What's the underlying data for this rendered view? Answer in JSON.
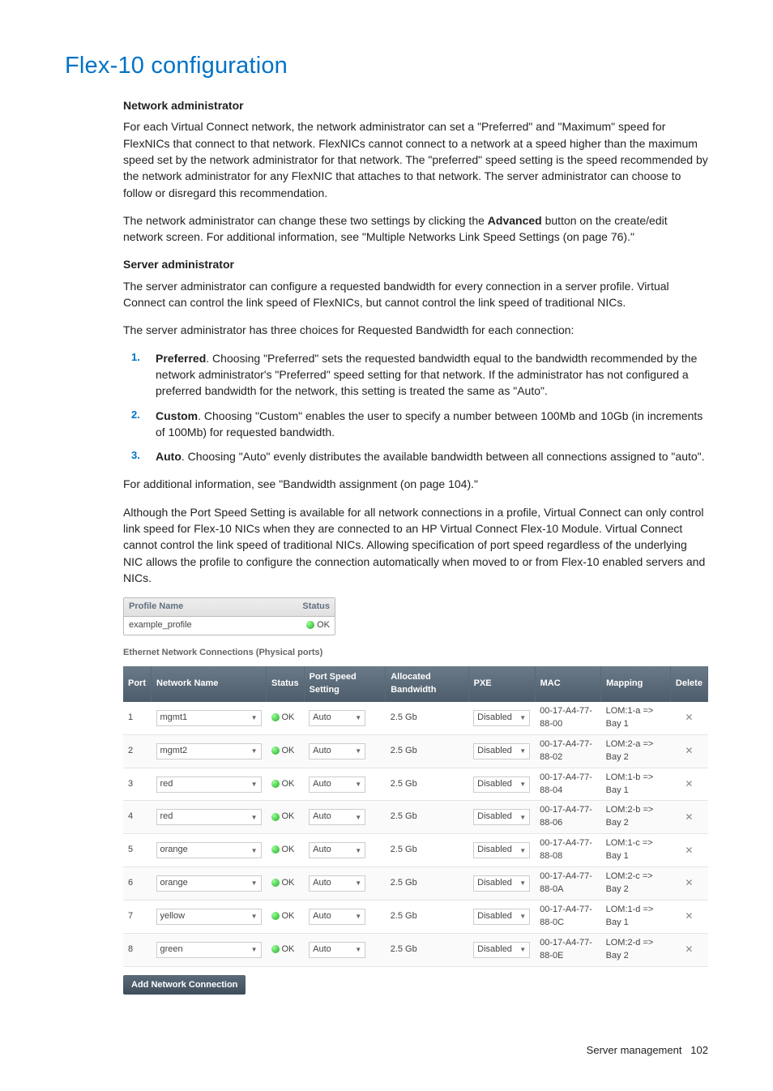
{
  "title": "Flex-10 configuration",
  "netAdmin": {
    "heading": "Network administrator",
    "p1": "For each Virtual Connect network, the network administrator can set a \"Preferred\" and \"Maximum\" speed for FlexNICs that connect to that network. FlexNICs cannot connect to a network at a speed higher than the maximum speed set by the network administrator for that network. The \"preferred\" speed setting is the speed recommended by the network administrator for any FlexNIC that attaches to that network. The server administrator can choose to follow or disregard this recommendation.",
    "p2a": "The network administrator can change these two settings by clicking the ",
    "p2b": "Advanced",
    "p2c": " button on the create/edit network screen. For additional information, see \"Multiple Networks Link Speed Settings (on page 76).\""
  },
  "srvAdmin": {
    "heading": "Server administrator",
    "p1": "The server administrator can configure a requested bandwidth for every connection in a server profile. Virtual Connect can control the link speed of FlexNICs, but cannot control the link speed of traditional NICs.",
    "p2": "The server administrator has three choices for Requested Bandwidth for each connection:",
    "li1b": "Preferred",
    "li1": ". Choosing \"Preferred\" sets the requested bandwidth equal to the bandwidth recommended by the network administrator's \"Preferred\" speed setting for that network. If the administrator has not configured a preferred bandwidth for the network, this setting is treated the same as \"Auto\".",
    "li2b": "Custom",
    "li2": ". Choosing \"Custom\" enables the user to specify a number between 100Mb and 10Gb (in increments of 100Mb) for requested bandwidth.",
    "li3b": "Auto",
    "li3": ". Choosing \"Auto\" evenly distributes the available bandwidth between all connections assigned to \"auto\".",
    "p3": "For additional information, see \"Bandwidth assignment (on page 104).\"",
    "p4": "Although the Port Speed Setting is available for all network connections in a profile, Virtual Connect can only control link speed for Flex-10 NICs when they are connected to an HP Virtual Connect Flex-10 Module. Virtual Connect cannot control the link speed of traditional NICs. Allowing specification of port speed regardless of the underlying NIC allows the profile to configure the connection automatically when moved to or from Flex-10 enabled servers and NICs."
  },
  "profile": {
    "hName": "Profile Name",
    "hStatus": "Status",
    "name": "example_profile",
    "status": "OK"
  },
  "connHead": "Ethernet Network Connections (Physical ports)",
  "cols": {
    "port": "Port",
    "net": "Network Name",
    "status": "Status",
    "pss": "Port Speed Setting",
    "bw": "Allocated Bandwidth",
    "pxe": "PXE",
    "mac": "MAC",
    "map": "Mapping",
    "del": "Delete"
  },
  "rows": [
    {
      "port": "1",
      "net": "mgmt1",
      "status": "OK",
      "pss": "Auto",
      "bw": "2.5 Gb",
      "pxe": "Disabled",
      "mac": "00-17-A4-77-88-00",
      "map": "LOM:1-a => Bay 1"
    },
    {
      "port": "2",
      "net": "mgmt2",
      "status": "OK",
      "pss": "Auto",
      "bw": "2.5 Gb",
      "pxe": "Disabled",
      "mac": "00-17-A4-77-88-02",
      "map": "LOM:2-a => Bay 2"
    },
    {
      "port": "3",
      "net": "red",
      "status": "OK",
      "pss": "Auto",
      "bw": "2.5 Gb",
      "pxe": "Disabled",
      "mac": "00-17-A4-77-88-04",
      "map": "LOM:1-b => Bay 1"
    },
    {
      "port": "4",
      "net": "red",
      "status": "OK",
      "pss": "Auto",
      "bw": "2.5 Gb",
      "pxe": "Disabled",
      "mac": "00-17-A4-77-88-06",
      "map": "LOM:2-b => Bay 2"
    },
    {
      "port": "5",
      "net": "orange",
      "status": "OK",
      "pss": "Auto",
      "bw": "2.5 Gb",
      "pxe": "Disabled",
      "mac": "00-17-A4-77-88-08",
      "map": "LOM:1-c => Bay 1"
    },
    {
      "port": "6",
      "net": "orange",
      "status": "OK",
      "pss": "Auto",
      "bw": "2.5 Gb",
      "pxe": "Disabled",
      "mac": "00-17-A4-77-88-0A",
      "map": "LOM:2-c => Bay 2"
    },
    {
      "port": "7",
      "net": "yellow",
      "status": "OK",
      "pss": "Auto",
      "bw": "2.5 Gb",
      "pxe": "Disabled",
      "mac": "00-17-A4-77-88-0C",
      "map": "LOM:1-d => Bay 1"
    },
    {
      "port": "8",
      "net": "green",
      "status": "OK",
      "pss": "Auto",
      "bw": "2.5 Gb",
      "pxe": "Disabled",
      "mac": "00-17-A4-77-88-0E",
      "map": "LOM:2-d => Bay 2"
    }
  ],
  "addBtn": "Add Network Connection",
  "footer": {
    "label": "Server management",
    "page": "102"
  }
}
